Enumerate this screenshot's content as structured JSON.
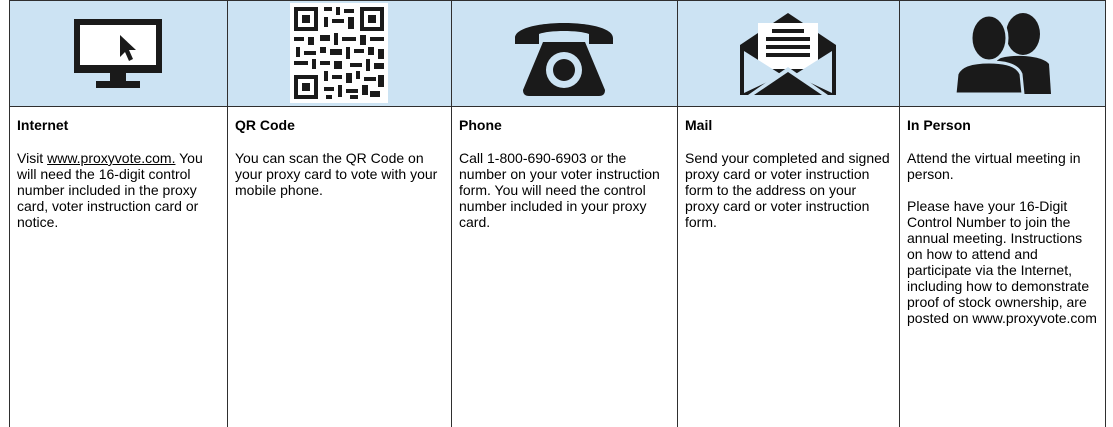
{
  "columns": [
    {
      "icon": "computer-monitor-icon",
      "title": "Internet",
      "body_prefix": "Visit ",
      "body_link": "www.proxyvote.com.",
      "body_rest": "You will need the 16-digit control number included in the proxy card, voter instruction card or notice."
    },
    {
      "icon": "qr-code-icon",
      "title": "QR Code",
      "body": "You can scan the QR Code on your proxy card to vote with your mobile phone."
    },
    {
      "icon": "telephone-icon",
      "title": "Phone",
      "body": "Call 1-800-690-6903 or the number on your voter instruction form. You will need the control number included in your proxy card."
    },
    {
      "icon": "envelope-letter-icon",
      "title": "Mail",
      "body": "Send your completed and signed proxy card or voter instruction form to the address on your proxy card or voter instruction form."
    },
    {
      "icon": "people-icon",
      "title": "In Person",
      "body_p1": "Attend the virtual meeting in person.",
      "body_p2": "Please have your 16-Digit Control Number to join the annual meeting. Instructions on how to attend and participate via the Internet, including how to demonstrate proof of stock ownership, are posted on www.proxyvote.com"
    }
  ],
  "colors": {
    "icon_bg": "#cce3f3",
    "icon_fg": "#1a1a1a",
    "border": "#2f2f2f"
  }
}
